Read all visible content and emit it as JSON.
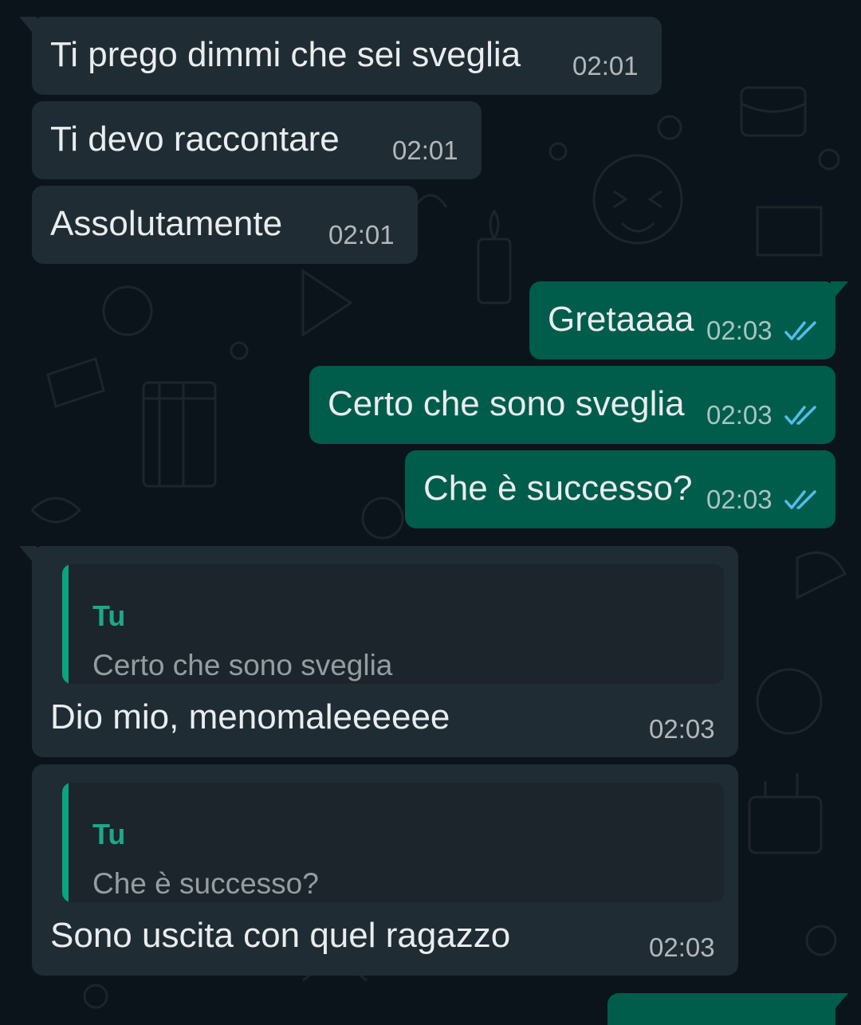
{
  "colors": {
    "background": "#0b141a",
    "incoming_bubble": "#202c33",
    "outgoing_bubble": "#005c4b",
    "quote_accent": "#06cf9c",
    "read_ticks": "#53bdeb"
  },
  "messages": [
    {
      "direction": "incoming",
      "text": "Ti prego dimmi che sei sveglia",
      "time": "02:01"
    },
    {
      "direction": "incoming",
      "text": "Ti devo raccontare",
      "time": "02:01"
    },
    {
      "direction": "incoming",
      "text": "Assolutamente",
      "time": "02:01"
    },
    {
      "direction": "outgoing",
      "text": "Gretaaaa",
      "time": "02:03",
      "status_icon": "double-check-read-icon"
    },
    {
      "direction": "outgoing",
      "text": "Certo che sono sveglia",
      "time": "02:03",
      "status_icon": "double-check-read-icon"
    },
    {
      "direction": "outgoing",
      "text": "Che è successo?",
      "time": "02:03",
      "status_icon": "double-check-read-icon"
    },
    {
      "direction": "incoming",
      "reply_to": {
        "author": "Tu",
        "text": "Certo che sono sveglia"
      },
      "text": "Dio mio, menomaleeeeee",
      "time": "02:03"
    },
    {
      "direction": "incoming",
      "reply_to": {
        "author": "Tu",
        "text": "Che è successo?"
      },
      "text": "Sono uscita con quel ragazzo",
      "time": "02:03"
    }
  ]
}
